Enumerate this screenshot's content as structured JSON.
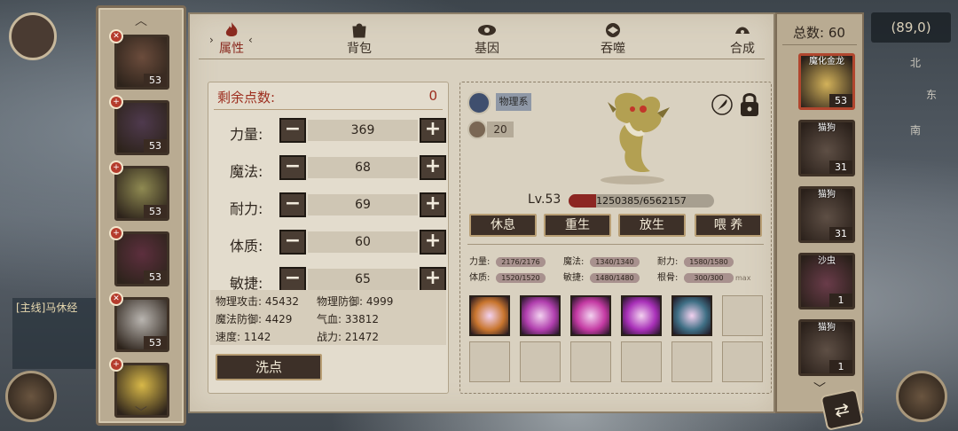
{
  "hud": {
    "coords": "(89,0)",
    "compass": {
      "north": "北",
      "east": "东",
      "south": "南"
    },
    "quest_snippet": "[主线]马休经"
  },
  "tabs": [
    {
      "label": "属性",
      "icon": "flame-icon",
      "active": true
    },
    {
      "label": "背包",
      "icon": "bag-icon",
      "active": false
    },
    {
      "label": "基因",
      "icon": "gene-icon",
      "active": false
    },
    {
      "label": "吞噬",
      "icon": "devour-icon",
      "active": false
    },
    {
      "label": "合成",
      "icon": "synthesis-icon",
      "active": false
    }
  ],
  "left_list": {
    "pets": [
      {
        "level": "53",
        "badge": "x",
        "color": "#6b4c3c"
      },
      {
        "level": "53",
        "badge": "+",
        "color": "#4f3a4e"
      },
      {
        "level": "53",
        "badge": "+",
        "color": "#8f8a52"
      },
      {
        "level": "53",
        "badge": "+",
        "color": "#5d2f3e"
      },
      {
        "level": "53",
        "badge": "x",
        "color": "#b9b5b0"
      },
      {
        "level": "",
        "badge": "+",
        "color": "#d8b848"
      }
    ]
  },
  "attributes": {
    "remaining_label": "剩余点数:",
    "remaining_value": "0",
    "stats": [
      {
        "label": "力量:",
        "value": "369"
      },
      {
        "label": "魔法:",
        "value": "68"
      },
      {
        "label": "耐力:",
        "value": "69"
      },
      {
        "label": "体质:",
        "value": "60"
      },
      {
        "label": "敏捷:",
        "value": "65"
      }
    ],
    "derived": {
      "phys_atk": "物理攻击: 45432",
      "phys_def": "物理防御: 4999",
      "magic_def": "魔法防御: 4429",
      "hp": "气血: 33812",
      "speed": "速度: 1142",
      "power": "战力: 21472"
    },
    "wash_label": "洗点"
  },
  "detail": {
    "type_tag": "物理系",
    "food_value": "20",
    "level": "Lv.53",
    "exp_text": "1250385/6562157",
    "exp_fraction": 0.19,
    "actions": [
      "休息",
      "重生",
      "放生",
      "喂  养"
    ],
    "aptitudes": [
      {
        "label": "力量:",
        "value": "2176/2176",
        "fill": 1.0
      },
      {
        "label": "魔法:",
        "value": "1340/1340",
        "fill": 1.0
      },
      {
        "label": "耐力:",
        "value": "1580/1580",
        "fill": 1.0
      },
      {
        "label": "体质:",
        "value": "1520/1520",
        "fill": 1.0
      },
      {
        "label": "敏捷:",
        "value": "1480/1480",
        "fill": 1.0
      },
      {
        "label": "根骨:",
        "value": "300/300",
        "fill": 1.0
      }
    ],
    "growth_max": "max",
    "skills": [
      {
        "icon": "wind-burst-icon",
        "color": "#c8752e"
      },
      {
        "icon": "slash-icon",
        "color": "#b13fae"
      },
      {
        "icon": "vortex-icon",
        "color": "#c43aa3"
      },
      {
        "icon": "lightning-slash-icon",
        "color": "#a830b8"
      },
      {
        "icon": "ice-shard-icon",
        "color": "#3f6f85"
      },
      {
        "icon": "",
        "color": ""
      },
      {
        "icon": "",
        "color": ""
      },
      {
        "icon": "",
        "color": ""
      },
      {
        "icon": "",
        "color": ""
      },
      {
        "icon": "",
        "color": ""
      },
      {
        "icon": "",
        "color": ""
      },
      {
        "icon": "",
        "color": ""
      }
    ]
  },
  "right_list": {
    "total_label": "总数: 60",
    "pets": [
      {
        "name": "魔化金龙",
        "level": "53",
        "color": "#d3b25a",
        "selected": true
      },
      {
        "name": "猫狗",
        "level": "31",
        "color": "#5e4f45",
        "selected": false
      },
      {
        "name": "猫狗",
        "level": "31",
        "color": "#5e4f45",
        "selected": false
      },
      {
        "name": "沙虫",
        "level": "1",
        "color": "#6a3c4a",
        "selected": false
      },
      {
        "name": "猫狗",
        "level": "1",
        "color": "#5e4f45",
        "selected": false
      }
    ]
  }
}
